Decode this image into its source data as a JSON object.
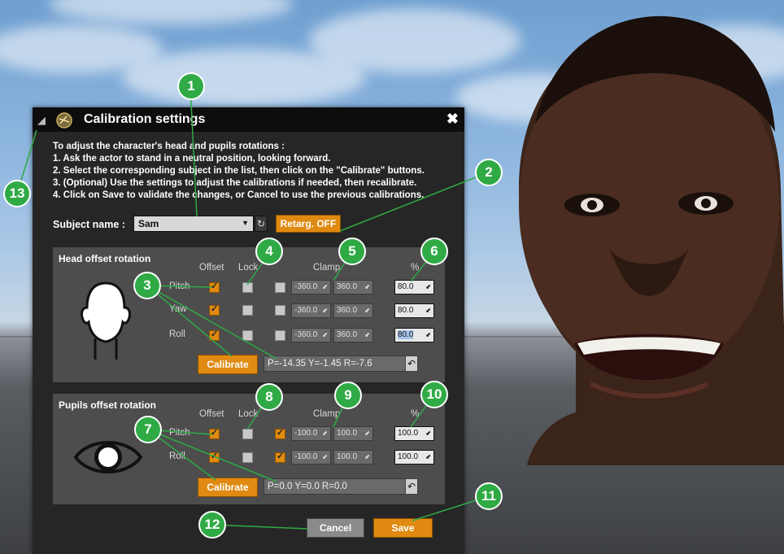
{
  "dialog": {
    "title": "Calibration settings",
    "close_glyph": "✖",
    "collapse_glyph": "◢",
    "instructions": [
      "To adjust the character's head and pupils rotations :",
      "1. Ask the actor to stand in a neutral position, looking forward.",
      "2. Select the corresponding subject in the list, then click on the \"Calibrate\" buttons.",
      "3. (Optional) Use the settings to adjust the calibrations if needed, then recalibrate.",
      "4. Click on Save to validate the changes, or Cancel to use the previous calibrations."
    ],
    "subject_label": "Subject name :",
    "subject_value": "Sam",
    "retarget_label": "Retarg. OFF",
    "head": {
      "title": "Head offset rotation",
      "col_offset": "Offset",
      "col_lock": "Lock",
      "col_clamp": "Clamp",
      "col_pct": "%",
      "rows": [
        {
          "label": "Pitch",
          "offset": true,
          "lock": false,
          "clamp": false,
          "min": "-360.0",
          "max": "360.0",
          "pct": "80.0"
        },
        {
          "label": "Yaw",
          "offset": true,
          "lock": false,
          "clamp": false,
          "min": "-360.0",
          "max": "360.0",
          "pct": "80.0"
        },
        {
          "label": "Roll",
          "offset": true,
          "lock": false,
          "clamp": false,
          "min": "-360.0",
          "max": "360.0",
          "pct": "80.0"
        }
      ],
      "calibrate_label": "Calibrate",
      "readout": "P=-14.35 Y=-1.45 R=-7.6"
    },
    "pupils": {
      "title": "Pupils offset rotation",
      "col_offset": "Offset",
      "col_lock": "Lock",
      "col_clamp": "Clamp",
      "col_pct": "%",
      "rows": [
        {
          "label": "Pitch",
          "offset": true,
          "lock": false,
          "clamp": true,
          "min": "-100.0",
          "max": "100.0",
          "pct": "100.0"
        },
        {
          "label": "Roll",
          "offset": true,
          "lock": false,
          "clamp": true,
          "min": "-100.0",
          "max": "100.0",
          "pct": "100.0"
        }
      ],
      "calibrate_label": "Calibrate",
      "readout": "P=0.0 Y=0.0 R=0.0"
    },
    "cancel_label": "Cancel",
    "save_label": "Save"
  },
  "callouts": [
    "1",
    "2",
    "3",
    "4",
    "5",
    "6",
    "7",
    "8",
    "9",
    "10",
    "11",
    "12",
    "13"
  ],
  "colors": {
    "accent": "#e08a12",
    "badge": "#2faa45",
    "panel": "#262626",
    "section": "#4d4d4d"
  }
}
